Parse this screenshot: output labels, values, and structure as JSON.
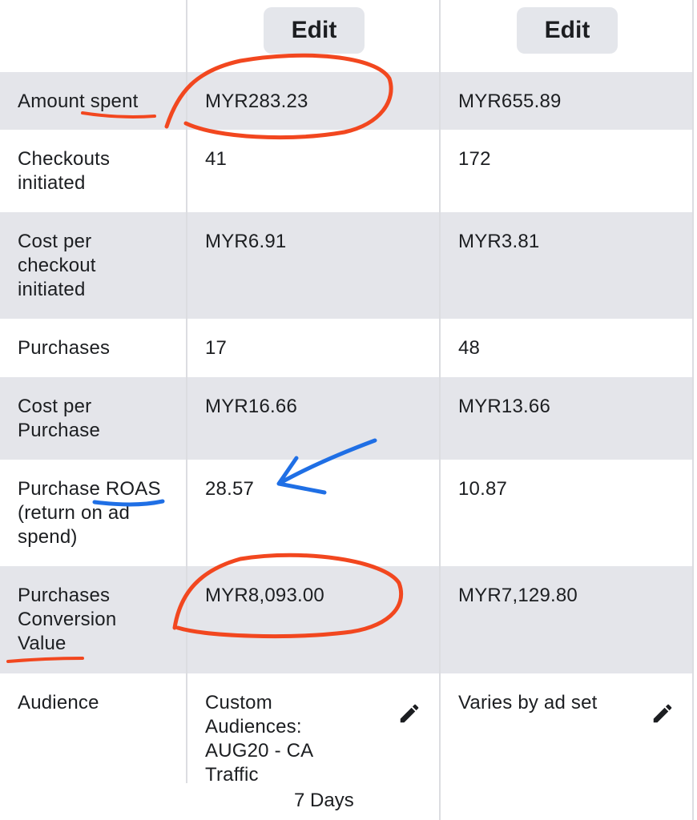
{
  "header": {
    "edit_label_1": "Edit",
    "edit_label_2": "Edit"
  },
  "rows": [
    {
      "label": "Amount spent",
      "a": "MYR283.23",
      "b": "MYR655.89"
    },
    {
      "label": "Checkouts initiated",
      "a": "41",
      "b": "172"
    },
    {
      "label": "Cost per checkout initiated",
      "a": "MYR6.91",
      "b": "MYR3.81"
    },
    {
      "label": "Purchases",
      "a": "17",
      "b": "48"
    },
    {
      "label": "Cost per Purchase",
      "a": "MYR16.66",
      "b": "MYR13.66"
    },
    {
      "label": "Purchase ROAS (return on ad spend)",
      "a": "28.57",
      "b": "10.87"
    },
    {
      "label": "Purchases Conversion Value",
      "a": "MYR8,093.00",
      "b": "MYR7,129.80"
    },
    {
      "label": "Audience",
      "a": "Custom Audiences: AUG20 - CA Traffic",
      "b": "Varies by ad set"
    }
  ],
  "footer_text": "7 Days",
  "icons": {
    "edit_audience": "pencil-icon"
  },
  "colors": {
    "annotation_red": "#f2471f",
    "annotation_blue": "#1f6fe5",
    "row_shade": "#e4e5ea",
    "button_bg": "#e4e6eb"
  }
}
